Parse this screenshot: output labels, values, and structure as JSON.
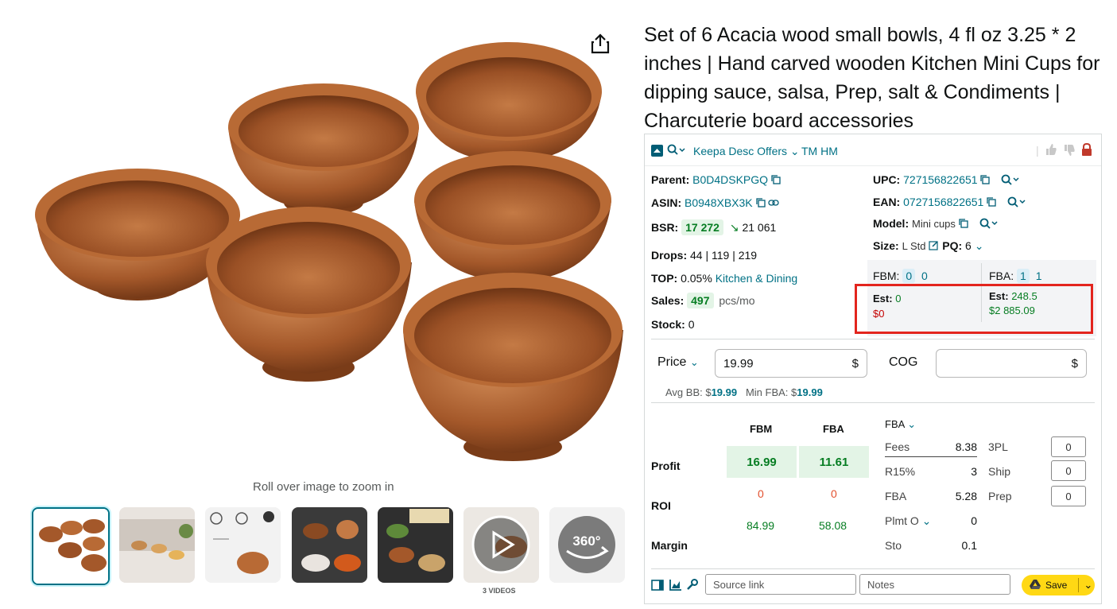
{
  "product": {
    "title": "Set of 6 Acacia wood small bowls, 4 fl oz 3.25 * 2 inches | Hand carved wooden Kitchen Mini Cups for dipping sauce, salsa, Prep, salt & Condiments | Charcuterie board accessories",
    "zoom_hint": "Roll over image to zoom in",
    "videos_label": "3 VIDEOS",
    "thumb_360": "360°"
  },
  "keepa": {
    "header_link": "Keepa Desc Offers",
    "header_tm": "TM HM",
    "parent_label": "Parent:",
    "parent_value": "B0D4DSKPGQ",
    "asin_label": "ASIN:",
    "asin_value": "B0948XBX3K",
    "bsr_label": "BSR:",
    "bsr_value": "17 272",
    "bsr_prev": "21 061",
    "drops_label": "Drops:",
    "drops_value": "44 | 119 | 219",
    "top_label": "TOP:",
    "top_value": "0.05%",
    "top_category": "Kitchen & Dining",
    "sales_label": "Sales:",
    "sales_value": "497",
    "sales_unit": "pcs/mo",
    "stock_label": "Stock:",
    "stock_value": "0",
    "upc_label": "UPC:",
    "upc_value": "727156822651",
    "ean_label": "EAN:",
    "ean_value": "0727156822651",
    "model_label": "Model:",
    "model_value": "Mini cups",
    "size_label": "Size:",
    "size_value": "L Std",
    "pq_label": "PQ:",
    "pq_value": "6",
    "fbm_label": "FBM:",
    "fbm_count1": "0",
    "fbm_count2": "0",
    "fba_label": "FBA:",
    "fba_count1": "1",
    "fba_count2": "1",
    "fbm_est_label": "Est:",
    "fbm_est_value": "0",
    "fbm_est_money": "$0",
    "fba_est_label": "Est:",
    "fba_est_value": "248.5",
    "fba_est_money": "$2 885.09",
    "price_label": "Price",
    "price_value": "19.99",
    "currency": "$",
    "cog_label": "COG",
    "cog_value": "",
    "avg_bb_label": "Avg BB: $",
    "avg_bb_value": "19.99",
    "min_fba_label": "Min FBA: $",
    "min_fba_value": "19.99",
    "col_fbm": "FBM",
    "col_fba": "FBA",
    "profit_label": "Profit",
    "profit_fbm": "16.99",
    "profit_fba": "11.61",
    "roi_label": "ROI",
    "roi_fbm": "0",
    "roi_fba": "0",
    "margin_fbm": "84.99",
    "margin_fba": "58.08",
    "margin_label": "Margin",
    "fees_mode": "FBA",
    "fees_label": "Fees",
    "fees_value": "8.38",
    "r15_label": "R15%",
    "r15_value": "3",
    "fba_fee_label": "FBA",
    "fba_fee_value": "5.28",
    "plmt_label": "Plmt O",
    "plmt_value": "0",
    "sto_label": "Sto",
    "sto_value": "0.1",
    "tpl_label": "3PL",
    "tpl_value": "0",
    "ship_label": "Ship",
    "ship_value": "0",
    "prep_label": "Prep",
    "prep_value": "0",
    "source_link_placeholder": "Source link",
    "notes_placeholder": "Notes",
    "save_label": "Save"
  },
  "colors": {
    "link": "#007185",
    "green": "#067d22",
    "red": "#c40000",
    "save": "#ffd814",
    "highlight": "#e3251e"
  }
}
